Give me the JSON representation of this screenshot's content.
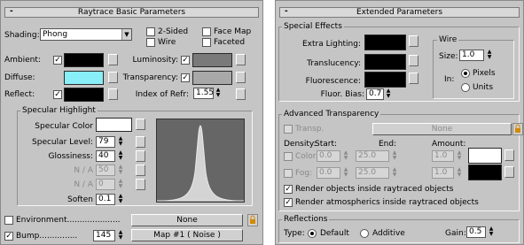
{
  "left": {
    "title": "Raytrace Basic Parameters",
    "shading_label": "Shading:",
    "shading_value": "Phong",
    "two_sided": "2-Sided",
    "wire": "Wire",
    "face_map": "Face Map",
    "faceted": "Faceted",
    "ambient": "Ambient:",
    "diffuse": "Diffuse:",
    "reflect": "Reflect:",
    "luminosity": "Luminosity:",
    "transparency": "Transparency:",
    "index_refr": "Index of Refr:",
    "index_value": "1.55",
    "specular_group": "Specular Highlight",
    "specular_color": "Specular Color",
    "specular_level": "Specular Level:",
    "specular_level_value": "79",
    "glossiness": "Glossiness:",
    "glossiness_value": "40",
    "na1": "N / A",
    "na1_value": "50",
    "na2": "N / A",
    "na2_value": "0",
    "soften": "Soften",
    "soften_value": "0.1",
    "environment": "Environment.....................",
    "env_map": "None",
    "bump": "Bump...............",
    "bump_value": "145",
    "bump_map": "Map #1  ( Noise )",
    "colors": {
      "ambient": "#000000",
      "diffuse": "#88eef8",
      "reflect": "#000000",
      "luminosity": "#7a7a7a",
      "transparency": "#a8a8a8",
      "specular": "#ffffff"
    }
  },
  "right": {
    "title": "Extended Parameters",
    "special_effects": "Special Effects",
    "extra_lighting": "Extra Lighting:",
    "translucency": "Translucency:",
    "fluorescence": "Fluorescence:",
    "fluor_bias": "Fluor. Bias:",
    "fluor_bias_value": "0.7",
    "wire_group": "Wire",
    "size_label": "Size:",
    "size_value": "1.0",
    "in_label": "In:",
    "pixels": "Pixels",
    "units": "Units",
    "adv_trans": "Advanced Transparency",
    "transp": "Transp.",
    "transp_map": "None",
    "density": "Density:",
    "start": "Start:",
    "end": "End:",
    "amount": "Amount:",
    "color": "Color:",
    "color_start": "0.0",
    "color_end": "25.0",
    "color_amount": "1.0",
    "fog": "Fog:",
    "fog_start": "0.0",
    "fog_end": "25.0",
    "fog_amount": "1.0",
    "render_objects": "Render objects inside raytraced objects",
    "render_atmo": "Render atmospherics inside raytraced objects",
    "reflections": "Reflections",
    "type_label": "Type:",
    "default": "Default",
    "additive": "Additive",
    "gain_label": "Gain:",
    "gain_value": "0.5"
  }
}
